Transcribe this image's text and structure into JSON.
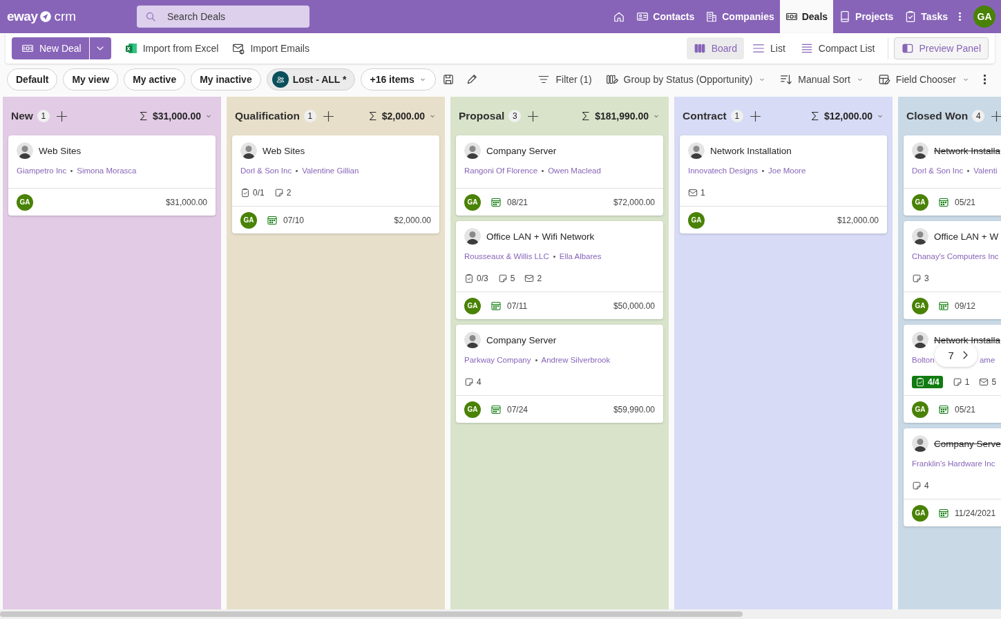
{
  "app": {
    "logo": "eway",
    "logo_suffix": "crm"
  },
  "search": {
    "placeholder": "Search Deals"
  },
  "nav": [
    {
      "kind": "home",
      "selected": false
    },
    {
      "kind": "contacts",
      "label": "Contacts",
      "selected": false
    },
    {
      "kind": "companies",
      "label": "Companies",
      "selected": false
    },
    {
      "kind": "deals",
      "label": "Deals",
      "selected": true
    },
    {
      "kind": "projects",
      "label": "Projects",
      "selected": false
    },
    {
      "kind": "tasks",
      "label": "Tasks",
      "selected": false
    },
    {
      "kind": "more",
      "selected": false
    }
  ],
  "user": {
    "initials": "GA"
  },
  "commands": {
    "new_button": "New Deal",
    "actions": [
      {
        "kind": "excel",
        "label": "Import from Excel"
      },
      {
        "kind": "email-import",
        "label": "Import Emails"
      }
    ],
    "views": [
      {
        "kind": "board",
        "label": "Board",
        "selected": true
      },
      {
        "kind": "list",
        "label": "List",
        "selected": false
      },
      {
        "kind": "compact",
        "label": "Compact List",
        "selected": false
      }
    ],
    "preview_button": "Preview Panel"
  },
  "view_chips": [
    {
      "label": "Default",
      "selected": false
    },
    {
      "label": "My view",
      "selected": false
    },
    {
      "label": "My active",
      "selected": false
    },
    {
      "label": "My inactive",
      "selected": false
    },
    {
      "label": "Lost - ALL *",
      "selected": true,
      "shared": true
    },
    {
      "label": "+16 items",
      "selected": false,
      "dropdown": true
    }
  ],
  "tools": [
    {
      "kind": "filter",
      "label": "Filter (1)",
      "dropdown": false
    },
    {
      "kind": "group",
      "label": "Group by Status (Opportunity)",
      "dropdown": true
    },
    {
      "kind": "sort",
      "label": "Manual Sort",
      "dropdown": true
    },
    {
      "kind": "fields",
      "label": "Field Chooser",
      "dropdown": true
    }
  ],
  "columns": [
    {
      "name": "New",
      "count": "1",
      "sum": "$31,000.00",
      "color": "#e2cbe5",
      "cards": [
        {
          "title": "Web Sites",
          "struck": false,
          "company": "Giampetro Inc",
          "contact": "Simona Morasca",
          "owner": "GA",
          "amount": "$31,000.00"
        }
      ]
    },
    {
      "name": "Qualification",
      "count": "1",
      "sum": "$2,000.00",
      "color": "#e7dfc9",
      "cards": [
        {
          "title": "Web Sites",
          "struck": false,
          "company": "Dorl & Son Inc",
          "contact": "Valentine Gillian",
          "stats": [
            {
              "kind": "tasks",
              "label": "0/1",
              "complete": false
            },
            {
              "kind": "notes",
              "label": "2"
            }
          ],
          "owner": "GA",
          "date": "07/10",
          "amount": "$2,000.00"
        }
      ]
    },
    {
      "name": "Proposal",
      "count": "3",
      "sum": "$181,990.00",
      "color": "#d8e3ca",
      "cards": [
        {
          "title": "Company Server",
          "struck": false,
          "company": "Rangoni Of Florence",
          "contact": "Owen Maclead",
          "owner": "GA",
          "date": "08/21",
          "amount": "$72,000.00"
        },
        {
          "title": "Office LAN + Wifi Network",
          "struck": false,
          "company": "Rousseaux & Willis LLC",
          "contact": "Ella Albares",
          "stats": [
            {
              "kind": "tasks",
              "label": "0/3",
              "complete": false
            },
            {
              "kind": "notes",
              "label": "5"
            },
            {
              "kind": "emails",
              "label": "2"
            }
          ],
          "owner": "GA",
          "date": "07/11",
          "amount": "$50,000.00"
        },
        {
          "title": "Company Server",
          "struck": false,
          "company": "Parkway Company",
          "contact": "Andrew Silverbrook",
          "stats": [
            {
              "kind": "notes",
              "label": "4"
            }
          ],
          "owner": "GA",
          "date": "07/24",
          "amount": "$59,990.00"
        }
      ]
    },
    {
      "name": "Contract",
      "count": "1",
      "sum": "$12,000.00",
      "color": "#d7dbf5",
      "cards": [
        {
          "title": "Network Installation",
          "struck": false,
          "company": "Innovatech Designs",
          "contact": "Joe Moore",
          "stats": [
            {
              "kind": "emails",
              "label": "1"
            }
          ],
          "owner": "GA",
          "amount": "$12,000.00"
        }
      ]
    },
    {
      "name": "Closed Won",
      "count": "4",
      "color": "#c9d9e6",
      "cards": [
        {
          "title": "Network Installa",
          "struck": true,
          "company": "Dorl & Son Inc",
          "contact": "Valenti",
          "owner": "GA",
          "date": "05/21"
        },
        {
          "title": "Office LAN + W",
          "struck": false,
          "company": "Chanay's Computers Inc",
          "stats": [
            {
              "kind": "notes",
              "label": "3"
            }
          ],
          "owner": "GA",
          "date": "09/12"
        },
        {
          "title": "Network Installa",
          "struck": true,
          "company": "Bolton",
          "contact": "ame",
          "pager": {
            "label": "7"
          },
          "stats": [
            {
              "kind": "tasks",
              "label": "4/4",
              "complete": true
            },
            {
              "kind": "notes",
              "label": "1"
            },
            {
              "kind": "emails",
              "label": "5"
            }
          ],
          "owner": "GA",
          "date": "05/21"
        },
        {
          "title": "Company Serve",
          "struck": true,
          "company": "Franklin's Hardware Inc",
          "stats": [
            {
              "kind": "notes",
              "label": "4"
            }
          ],
          "owner": "GA",
          "date": "11/24/2021"
        }
      ]
    }
  ]
}
